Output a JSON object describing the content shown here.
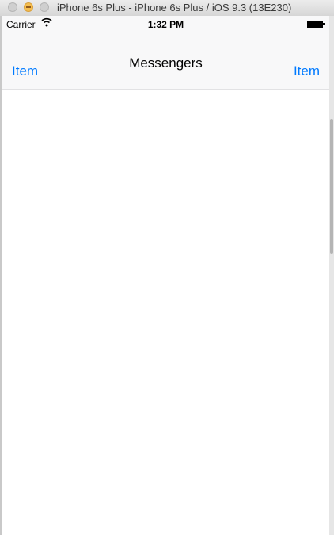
{
  "window": {
    "title": "iPhone 6s Plus - iPhone 6s Plus / iOS 9.3 (13E230)"
  },
  "status_bar": {
    "carrier": "Carrier",
    "time": "1:32 PM",
    "icons": [
      "wifi-icon",
      "battery-icon"
    ]
  },
  "nav_bar": {
    "title": "Messengers",
    "left_item": "Item",
    "right_item": "Item"
  },
  "colors": {
    "tint": "#007aff",
    "nav_background": "#f8f8f9"
  }
}
